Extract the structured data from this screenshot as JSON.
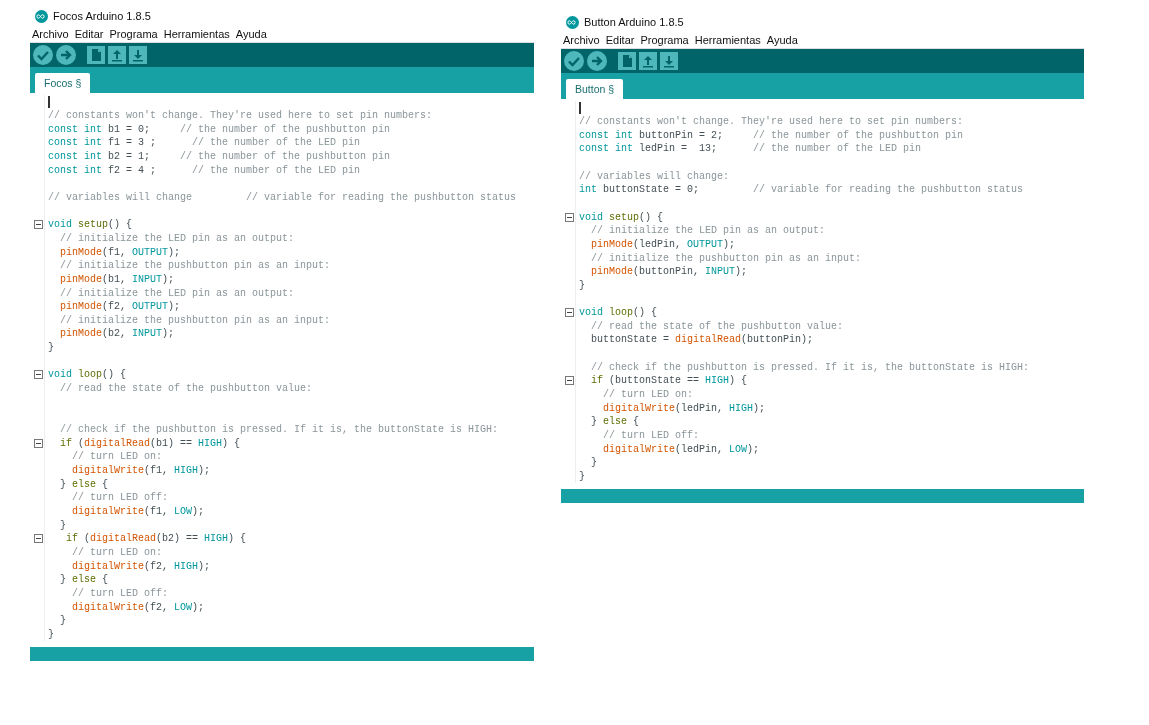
{
  "windows": [
    {
      "title": "Focos Arduino 1.8.5",
      "menu": [
        "Archivo",
        "Editar",
        "Programa",
        "Herramientas",
        "Ayuda"
      ],
      "tabs": [
        {
          "label": "Focos §",
          "selected": true
        }
      ],
      "code": [
        {
          "kind": "blank",
          "cursor": true
        },
        {
          "kind": "code",
          "tokens": [
            {
              "kind": "comment",
              "text": "// constants won't change. They're used here to set pin numbers:"
            }
          ]
        },
        {
          "kind": "code",
          "tokens": [
            {
              "kind": "keyword",
              "text": "const int"
            },
            {
              "kind": "plain",
              "text": " b1 = 0;     "
            },
            {
              "kind": "comment",
              "text": "// the number of the pushbutton pin"
            }
          ]
        },
        {
          "kind": "code",
          "tokens": [
            {
              "kind": "keyword",
              "text": "const int"
            },
            {
              "kind": "plain",
              "text": " f1 = 3 ;      "
            },
            {
              "kind": "comment",
              "text": "// the number of the LED pin"
            }
          ]
        },
        {
          "kind": "code",
          "tokens": [
            {
              "kind": "keyword",
              "text": "const int"
            },
            {
              "kind": "plain",
              "text": " b2 = 1;     "
            },
            {
              "kind": "comment",
              "text": "// the number of the pushbutton pin"
            }
          ]
        },
        {
          "kind": "code",
          "tokens": [
            {
              "kind": "keyword",
              "text": "const int"
            },
            {
              "kind": "plain",
              "text": " f2 = 4 ;      "
            },
            {
              "kind": "comment",
              "text": "// the number of the LED pin"
            }
          ]
        },
        {
          "kind": "blank"
        },
        {
          "kind": "code",
          "tokens": [
            {
              "kind": "comment",
              "text": "// variables will change         // variable for reading the pushbutton status"
            }
          ]
        },
        {
          "kind": "blank"
        },
        {
          "kind": "code",
          "fold": true,
          "tokens": [
            {
              "kind": "keyword",
              "text": "void "
            },
            {
              "kind": "block",
              "text": "setup"
            },
            {
              "kind": "plain",
              "text": "() {"
            }
          ]
        },
        {
          "kind": "code",
          "tokens": [
            {
              "kind": "comment",
              "text": "  // initialize the LED pin as an output:"
            }
          ]
        },
        {
          "kind": "code",
          "tokens": [
            {
              "kind": "function",
              "text": "  pinMode"
            },
            {
              "kind": "plain",
              "text": "(f1, "
            },
            {
              "kind": "keyword",
              "text": "OUTPUT"
            },
            {
              "kind": "plain",
              "text": ");"
            }
          ]
        },
        {
          "kind": "code",
          "tokens": [
            {
              "kind": "comment",
              "text": "  // initialize the pushbutton pin as an input:"
            }
          ]
        },
        {
          "kind": "code",
          "tokens": [
            {
              "kind": "function",
              "text": "  pinMode"
            },
            {
              "kind": "plain",
              "text": "(b1, "
            },
            {
              "kind": "keyword",
              "text": "INPUT"
            },
            {
              "kind": "plain",
              "text": ");"
            }
          ]
        },
        {
          "kind": "code",
          "tokens": [
            {
              "kind": "comment",
              "text": "  // initialize the LED pin as an output:"
            }
          ]
        },
        {
          "kind": "code",
          "tokens": [
            {
              "kind": "function",
              "text": "  pinMode"
            },
            {
              "kind": "plain",
              "text": "(f2, "
            },
            {
              "kind": "keyword",
              "text": "OUTPUT"
            },
            {
              "kind": "plain",
              "text": ");"
            }
          ]
        },
        {
          "kind": "code",
          "tokens": [
            {
              "kind": "comment",
              "text": "  // initialize the pushbutton pin as an input:"
            }
          ]
        },
        {
          "kind": "code",
          "tokens": [
            {
              "kind": "function",
              "text": "  pinMode"
            },
            {
              "kind": "plain",
              "text": "(b2, "
            },
            {
              "kind": "keyword",
              "text": "INPUT"
            },
            {
              "kind": "plain",
              "text": ");"
            }
          ]
        },
        {
          "kind": "code",
          "tokens": [
            {
              "kind": "plain",
              "text": "}"
            }
          ]
        },
        {
          "kind": "blank"
        },
        {
          "kind": "code",
          "fold": true,
          "tokens": [
            {
              "kind": "keyword",
              "text": "void "
            },
            {
              "kind": "block",
              "text": "loop"
            },
            {
              "kind": "plain",
              "text": "() {"
            }
          ]
        },
        {
          "kind": "code",
          "tokens": [
            {
              "kind": "comment",
              "text": "  // read the state of the pushbutton value:"
            }
          ]
        },
        {
          "kind": "blank"
        },
        {
          "kind": "blank"
        },
        {
          "kind": "code",
          "tokens": [
            {
              "kind": "comment",
              "text": "  // check if the pushbutton is pressed. If it is, the buttonState is HIGH:"
            }
          ]
        },
        {
          "kind": "code",
          "fold": true,
          "tokens": [
            {
              "kind": "block",
              "text": "  if"
            },
            {
              "kind": "plain",
              "text": " ("
            },
            {
              "kind": "function",
              "text": "digitalRead"
            },
            {
              "kind": "plain",
              "text": "(b1) == "
            },
            {
              "kind": "keyword",
              "text": "HIGH"
            },
            {
              "kind": "plain",
              "text": ") {"
            }
          ]
        },
        {
          "kind": "code",
          "tokens": [
            {
              "kind": "comment",
              "text": "    // turn LED on:"
            }
          ]
        },
        {
          "kind": "code",
          "tokens": [
            {
              "kind": "function",
              "text": "    digitalWrite"
            },
            {
              "kind": "plain",
              "text": "(f1, "
            },
            {
              "kind": "keyword",
              "text": "HIGH"
            },
            {
              "kind": "plain",
              "text": ");"
            }
          ]
        },
        {
          "kind": "code",
          "tokens": [
            {
              "kind": "plain",
              "text": "  } "
            },
            {
              "kind": "block",
              "text": "else"
            },
            {
              "kind": "plain",
              "text": " {"
            }
          ]
        },
        {
          "kind": "code",
          "tokens": [
            {
              "kind": "comment",
              "text": "    // turn LED off:"
            }
          ]
        },
        {
          "kind": "code",
          "tokens": [
            {
              "kind": "function",
              "text": "    digitalWrite"
            },
            {
              "kind": "plain",
              "text": "(f1, "
            },
            {
              "kind": "keyword",
              "text": "LOW"
            },
            {
              "kind": "plain",
              "text": ");"
            }
          ]
        },
        {
          "kind": "code",
          "tokens": [
            {
              "kind": "plain",
              "text": "  }"
            }
          ]
        },
        {
          "kind": "code",
          "fold": true,
          "tokens": [
            {
              "kind": "block",
              "text": "   if"
            },
            {
              "kind": "plain",
              "text": " ("
            },
            {
              "kind": "function",
              "text": "digitalRead"
            },
            {
              "kind": "plain",
              "text": "(b2) == "
            },
            {
              "kind": "keyword",
              "text": "HIGH"
            },
            {
              "kind": "plain",
              "text": ") {"
            }
          ]
        },
        {
          "kind": "code",
          "tokens": [
            {
              "kind": "comment",
              "text": "    // turn LED on:"
            }
          ]
        },
        {
          "kind": "code",
          "tokens": [
            {
              "kind": "function",
              "text": "    digitalWrite"
            },
            {
              "kind": "plain",
              "text": "(f2, "
            },
            {
              "kind": "keyword",
              "text": "HIGH"
            },
            {
              "kind": "plain",
              "text": ");"
            }
          ]
        },
        {
          "kind": "code",
          "tokens": [
            {
              "kind": "plain",
              "text": "  } "
            },
            {
              "kind": "block",
              "text": "else"
            },
            {
              "kind": "plain",
              "text": " {"
            }
          ]
        },
        {
          "kind": "code",
          "tokens": [
            {
              "kind": "comment",
              "text": "    // turn LED off:"
            }
          ]
        },
        {
          "kind": "code",
          "tokens": [
            {
              "kind": "function",
              "text": "    digitalWrite"
            },
            {
              "kind": "plain",
              "text": "(f2, "
            },
            {
              "kind": "keyword",
              "text": "LOW"
            },
            {
              "kind": "plain",
              "text": ");"
            }
          ]
        },
        {
          "kind": "code",
          "tokens": [
            {
              "kind": "plain",
              "text": "  }"
            }
          ]
        },
        {
          "kind": "code",
          "tokens": [
            {
              "kind": "plain",
              "text": "}"
            }
          ]
        }
      ]
    },
    {
      "title": "Button Arduino 1.8.5",
      "menu": [
        "Archivo",
        "Editar",
        "Programa",
        "Herramientas",
        "Ayuda"
      ],
      "tabs": [
        {
          "label": "Button §",
          "selected": true
        }
      ],
      "code": [
        {
          "kind": "blank",
          "cursor": true
        },
        {
          "kind": "code",
          "tokens": [
            {
              "kind": "comment",
              "text": "// constants won't change. They're used here to set pin numbers:"
            }
          ]
        },
        {
          "kind": "code",
          "tokens": [
            {
              "kind": "keyword",
              "text": "const int"
            },
            {
              "kind": "plain",
              "text": " buttonPin = 2;     "
            },
            {
              "kind": "comment",
              "text": "// the number of the pushbutton pin"
            }
          ]
        },
        {
          "kind": "code",
          "tokens": [
            {
              "kind": "keyword",
              "text": "const int"
            },
            {
              "kind": "plain",
              "text": " ledPin =  13;      "
            },
            {
              "kind": "comment",
              "text": "// the number of the LED pin"
            }
          ]
        },
        {
          "kind": "blank"
        },
        {
          "kind": "code",
          "tokens": [
            {
              "kind": "comment",
              "text": "// variables will change:"
            }
          ]
        },
        {
          "kind": "code",
          "tokens": [
            {
              "kind": "keyword",
              "text": "int"
            },
            {
              "kind": "plain",
              "text": " buttonState = 0;         "
            },
            {
              "kind": "comment",
              "text": "// variable for reading the pushbutton status"
            }
          ]
        },
        {
          "kind": "blank"
        },
        {
          "kind": "code",
          "fold": true,
          "tokens": [
            {
              "kind": "keyword",
              "text": "void "
            },
            {
              "kind": "block",
              "text": "setup"
            },
            {
              "kind": "plain",
              "text": "() {"
            }
          ]
        },
        {
          "kind": "code",
          "tokens": [
            {
              "kind": "comment",
              "text": "  // initialize the LED pin as an output:"
            }
          ]
        },
        {
          "kind": "code",
          "tokens": [
            {
              "kind": "function",
              "text": "  pinMode"
            },
            {
              "kind": "plain",
              "text": "(ledPin, "
            },
            {
              "kind": "keyword",
              "text": "OUTPUT"
            },
            {
              "kind": "plain",
              "text": ");"
            }
          ]
        },
        {
          "kind": "code",
          "tokens": [
            {
              "kind": "comment",
              "text": "  // initialize the pushbutton pin as an input:"
            }
          ]
        },
        {
          "kind": "code",
          "tokens": [
            {
              "kind": "function",
              "text": "  pinMode"
            },
            {
              "kind": "plain",
              "text": "(buttonPin, "
            },
            {
              "kind": "keyword",
              "text": "INPUT"
            },
            {
              "kind": "plain",
              "text": ");"
            }
          ]
        },
        {
          "kind": "code",
          "tokens": [
            {
              "kind": "plain",
              "text": "}"
            }
          ]
        },
        {
          "kind": "blank"
        },
        {
          "kind": "code",
          "fold": true,
          "tokens": [
            {
              "kind": "keyword",
              "text": "void "
            },
            {
              "kind": "block",
              "text": "loop"
            },
            {
              "kind": "plain",
              "text": "() {"
            }
          ]
        },
        {
          "kind": "code",
          "tokens": [
            {
              "kind": "comment",
              "text": "  // read the state of the pushbutton value:"
            }
          ]
        },
        {
          "kind": "code",
          "tokens": [
            {
              "kind": "plain",
              "text": "  buttonState = "
            },
            {
              "kind": "function",
              "text": "digitalRead"
            },
            {
              "kind": "plain",
              "text": "(buttonPin);"
            }
          ]
        },
        {
          "kind": "blank"
        },
        {
          "kind": "code",
          "tokens": [
            {
              "kind": "comment",
              "text": "  // check if the pushbutton is pressed. If it is, the buttonState is HIGH:"
            }
          ]
        },
        {
          "kind": "code",
          "fold": true,
          "tokens": [
            {
              "kind": "block",
              "text": "  if"
            },
            {
              "kind": "plain",
              "text": " (buttonState == "
            },
            {
              "kind": "keyword",
              "text": "HIGH"
            },
            {
              "kind": "plain",
              "text": ") {"
            }
          ]
        },
        {
          "kind": "code",
          "tokens": [
            {
              "kind": "comment",
              "text": "    // turn LED on:"
            }
          ]
        },
        {
          "kind": "code",
          "tokens": [
            {
              "kind": "function",
              "text": "    digitalWrite"
            },
            {
              "kind": "plain",
              "text": "(ledPin, "
            },
            {
              "kind": "keyword",
              "text": "HIGH"
            },
            {
              "kind": "plain",
              "text": ");"
            }
          ]
        },
        {
          "kind": "code",
          "tokens": [
            {
              "kind": "plain",
              "text": "  } "
            },
            {
              "kind": "block",
              "text": "else"
            },
            {
              "kind": "plain",
              "text": " {"
            }
          ]
        },
        {
          "kind": "code",
          "tokens": [
            {
              "kind": "comment",
              "text": "    // turn LED off:"
            }
          ]
        },
        {
          "kind": "code",
          "tokens": [
            {
              "kind": "function",
              "text": "    digitalWrite"
            },
            {
              "kind": "plain",
              "text": "(ledPin, "
            },
            {
              "kind": "keyword",
              "text": "LOW"
            },
            {
              "kind": "plain",
              "text": ");"
            }
          ]
        },
        {
          "kind": "code",
          "tokens": [
            {
              "kind": "plain",
              "text": "  }"
            }
          ]
        },
        {
          "kind": "code",
          "tokens": [
            {
              "kind": "plain",
              "text": "}"
            }
          ]
        }
      ]
    }
  ]
}
